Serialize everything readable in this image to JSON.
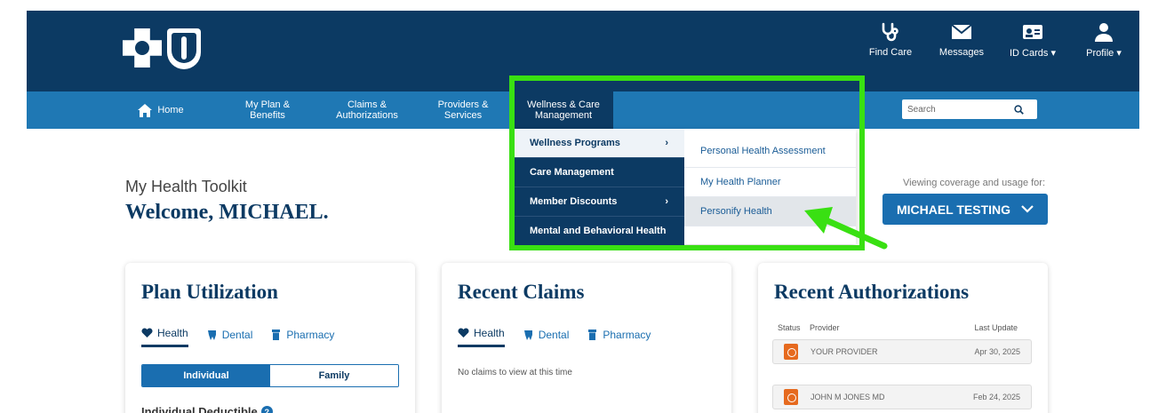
{
  "header": {
    "icons": [
      {
        "name": "stethoscope-icon",
        "label": "Find Care"
      },
      {
        "name": "envelope-icon",
        "label": "Messages"
      },
      {
        "name": "id-card-icon",
        "label": "ID Cards"
      },
      {
        "name": "user-icon",
        "label": "Profile"
      }
    ]
  },
  "nav": {
    "home": "Home",
    "plan": "My Plan & Benefits",
    "claims": "Claims & Authorizations",
    "providers": "Providers & Services",
    "wellness": "Wellness & Care Management",
    "search_placeholder": "Search"
  },
  "dropdown": {
    "left": [
      "Wellness Programs",
      "Care Management",
      "Member Discounts",
      "Mental and Behavioral Health"
    ],
    "right": [
      "Personal Health Assessment",
      "My Health Planner",
      "Personify Health"
    ]
  },
  "toolkit": {
    "subtitle": "My Health Toolkit",
    "welcome": "Welcome, MICHAEL."
  },
  "coverage": {
    "label": "Viewing coverage and usage for:",
    "user": "MICHAEL TESTING"
  },
  "plan_card": {
    "title": "Plan Utilization",
    "tabs": [
      "Health",
      "Dental",
      "Pharmacy"
    ],
    "toggle": [
      "Individual",
      "Family"
    ],
    "deductible": "Individual Deductible"
  },
  "claims_card": {
    "title": "Recent Claims",
    "tabs": [
      "Health",
      "Dental",
      "Pharmacy"
    ],
    "empty": "No claims to view at this time"
  },
  "auth_card": {
    "title": "Recent Authorizations",
    "headers": [
      "Status",
      "Provider",
      "Last Update"
    ],
    "rows": [
      {
        "provider": "YOUR PROVIDER",
        "date": "Apr 30, 2025"
      },
      {
        "provider": "JOHN M JONES MD",
        "date": "Feb 24, 2025"
      }
    ]
  },
  "colors": {
    "navy": "#0c3a63",
    "blue": "#1f78b4",
    "highlight": "#39e012"
  }
}
